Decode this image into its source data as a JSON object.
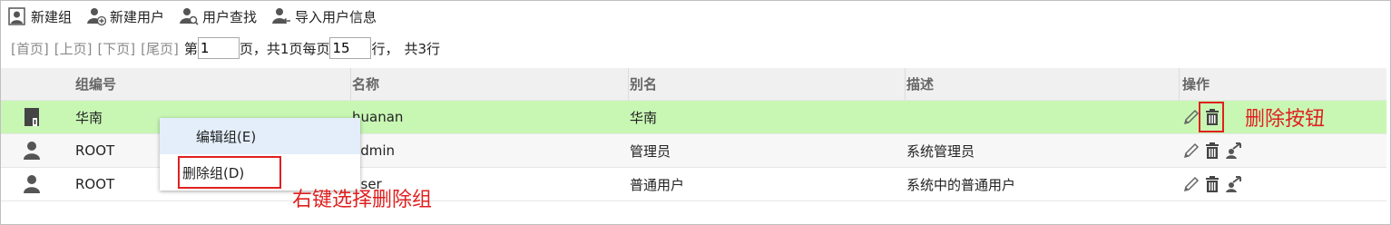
{
  "toolbar": {
    "new_group": "新建组",
    "new_user": "新建用户",
    "find_user": "用户查找",
    "import_user": "导入用户信息"
  },
  "pager": {
    "first": "[首页]",
    "prev": "[上页]",
    "next": "[下页]",
    "last": "[尾页]",
    "page_prefix": "第",
    "page_value": "1",
    "page_suffix": "页，",
    "total_pages": "共1页",
    "per_page_prefix": "每页",
    "per_page_value": "15",
    "per_page_suffix": "行，",
    "total_rows": "共3行"
  },
  "table": {
    "headers": [
      "组编号",
      "名称",
      "别名",
      "描述",
      "操作"
    ],
    "rows": [
      {
        "icon": "group-icon",
        "group_no": "华南",
        "name": "huanan",
        "alias": "华南",
        "desc": ""
      },
      {
        "icon": "user-icon",
        "group_no": "ROOT",
        "name": "admin",
        "alias": "管理员",
        "desc": "系统管理员"
      },
      {
        "icon": "user-icon",
        "group_no": "ROOT",
        "name": "user",
        "alias": "普通用户",
        "desc": "系统中的普通用户"
      }
    ]
  },
  "context_menu": {
    "edit_group": "编辑组(E)",
    "delete_group": "删除组(D)"
  },
  "annotations": {
    "delete_button": "删除按钮",
    "right_click_delete": "右键选择删除组"
  },
  "colors": {
    "selected_row": "#c8f7b4",
    "annotation_red": "#e02020",
    "menu_hover": "#e3eefa"
  }
}
